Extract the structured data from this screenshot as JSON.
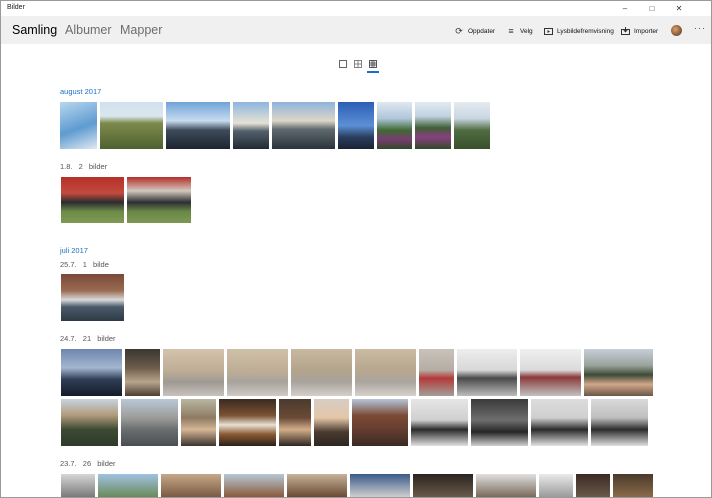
{
  "window": {
    "title": "Bilder"
  },
  "header": {
    "tabs": [
      {
        "label": "Samling",
        "active": true
      },
      {
        "label": "Albumer",
        "active": false
      },
      {
        "label": "Mapper",
        "active": false
      }
    ],
    "actions": [
      {
        "label": "Oppdater",
        "icon": "refresh-icon"
      },
      {
        "label": "Velg",
        "icon": "select-icon"
      },
      {
        "label": "Lysbildefremvisning",
        "icon": "slideshow-icon"
      },
      {
        "label": "Importer",
        "icon": "import-icon"
      }
    ],
    "more": "···"
  },
  "view_switcher": {
    "active": "small-grid"
  },
  "months": [
    {
      "label": "august 2017"
    },
    {
      "label": "juli 2017"
    }
  ],
  "groups": [
    {
      "date": "1.8.",
      "count": "2 bilder"
    },
    {
      "date": "25.7.",
      "count": "1 bilde"
    },
    {
      "date": "24.7.",
      "count": "21 bilder"
    },
    {
      "date": "23.7.",
      "count": "26 bilder"
    }
  ],
  "colors": {
    "accent": "#1a6fc2",
    "header_bg": "#f0f0f0"
  }
}
